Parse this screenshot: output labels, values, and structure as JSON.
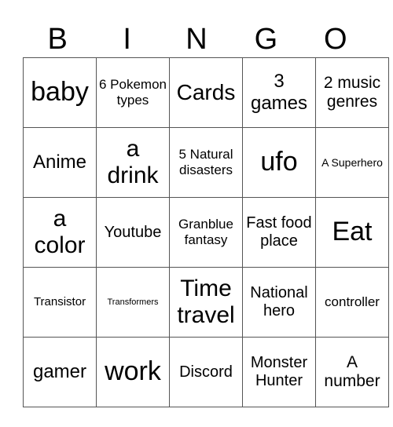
{
  "header": [
    "B",
    "I",
    "N",
    "G",
    "O"
  ],
  "cells": [
    [
      {
        "t": "baby",
        "s": 34
      },
      {
        "t": "6 Pokemon types",
        "s": 17
      },
      {
        "t": "Cards",
        "s": 28
      },
      {
        "t": "3 games",
        "s": 24
      },
      {
        "t": "2 music genres",
        "s": 21
      }
    ],
    [
      {
        "t": "Anime",
        "s": 24
      },
      {
        "t": "a drink",
        "s": 30
      },
      {
        "t": "5 Natural disasters",
        "s": 17
      },
      {
        "t": "ufo",
        "s": 34
      },
      {
        "t": "A Superhero",
        "s": 14
      }
    ],
    [
      {
        "t": "a color",
        "s": 30
      },
      {
        "t": "Youtube",
        "s": 20
      },
      {
        "t": "Granblue fantasy",
        "s": 17
      },
      {
        "t": "Fast food place",
        "s": 20
      },
      {
        "t": "Eat",
        "s": 34
      }
    ],
    [
      {
        "t": "Transistor",
        "s": 15
      },
      {
        "t": "Transformers",
        "s": 11
      },
      {
        "t": "Time travel",
        "s": 30
      },
      {
        "t": "National hero",
        "s": 20
      },
      {
        "t": "controller",
        "s": 17
      }
    ],
    [
      {
        "t": "gamer",
        "s": 24
      },
      {
        "t": "work",
        "s": 34
      },
      {
        "t": "Discord",
        "s": 20
      },
      {
        "t": "Monster Hunter",
        "s": 20
      },
      {
        "t": "A number",
        "s": 21
      }
    ]
  ]
}
